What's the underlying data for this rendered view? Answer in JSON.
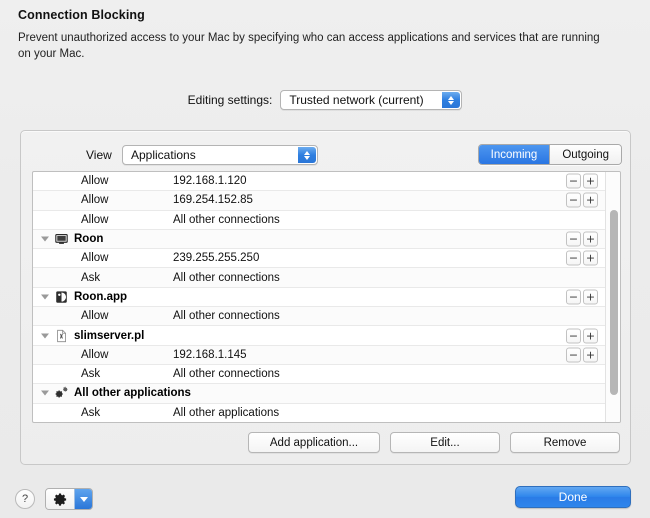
{
  "header": {
    "title": "Connection Blocking",
    "description": "Prevent unauthorized access to your Mac by specifying who can access applications and services that are running on your Mac."
  },
  "editing_settings": {
    "label": "Editing settings:",
    "value": "Trusted network (current)",
    "stepper_icon": "up-down-stepper-icon"
  },
  "panel": {
    "view": {
      "label": "View",
      "value": "Applications",
      "stepper_icon": "up-down-stepper-icon"
    },
    "direction_tabs": [
      {
        "label": "Incoming",
        "selected": true
      },
      {
        "label": "Outgoing",
        "selected": false
      }
    ],
    "rows": [
      {
        "type": "rule",
        "action": "Allow",
        "target": "192.168.1.120",
        "buttons": true
      },
      {
        "type": "rule",
        "action": "Allow",
        "target": "169.254.152.85",
        "buttons": true
      },
      {
        "type": "rule",
        "action": "Allow",
        "target": "All other connections",
        "buttons": false
      },
      {
        "type": "group",
        "label": "Roon",
        "icon": "display-icon",
        "buttons": true
      },
      {
        "type": "rule",
        "action": "Allow",
        "target": "239.255.255.250",
        "buttons": true
      },
      {
        "type": "rule",
        "action": "Ask",
        "target": "All other connections",
        "buttons": false
      },
      {
        "type": "group",
        "label": "Roon.app",
        "icon": "app-icon",
        "buttons": true
      },
      {
        "type": "rule",
        "action": "Allow",
        "target": "All other connections",
        "buttons": false
      },
      {
        "type": "group",
        "label": "slimserver.pl",
        "icon": "script-file-icon",
        "buttons": true
      },
      {
        "type": "rule",
        "action": "Allow",
        "target": "192.168.1.145",
        "buttons": true
      },
      {
        "type": "rule",
        "action": "Ask",
        "target": "All other connections",
        "buttons": false
      },
      {
        "type": "group",
        "label": "All other applications",
        "icon": "gears-icon",
        "buttons": false
      },
      {
        "type": "rule",
        "action": "Ask",
        "target": "All other applications",
        "buttons": false
      }
    ],
    "row_buttons": {
      "minus": "−",
      "plus": "+"
    },
    "actions": [
      {
        "name": "add-application",
        "label": "Add application..."
      },
      {
        "name": "edit",
        "label": "Edit..."
      },
      {
        "name": "remove",
        "label": "Remove"
      }
    ]
  },
  "footer": {
    "help_label": "?",
    "action_menu_icon": "gear-icon",
    "action_menu_arrow_icon": "chevron-down-icon",
    "done_label": "Done"
  },
  "colors": {
    "accent": "#2f86ec",
    "segment_selected": "#2a76e3",
    "window_background": "#ececec",
    "list_background": "#ffffff"
  }
}
